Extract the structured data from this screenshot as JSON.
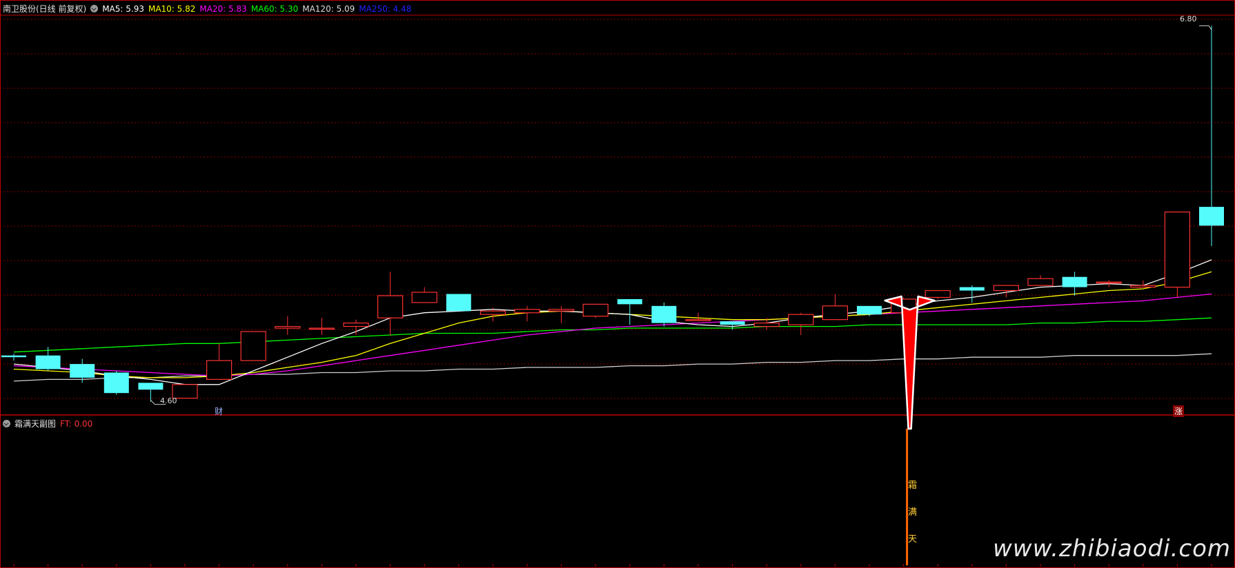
{
  "header": {
    "title": "南卫股份(日线 前复权)",
    "ma_items": [
      {
        "label": "MA5:",
        "value": "5.93",
        "color": "#ffffff"
      },
      {
        "label": "MA10:",
        "value": "5.82",
        "color": "#ffff00"
      },
      {
        "label": "MA20:",
        "value": "5.83",
        "color": "#ff00ff"
      },
      {
        "label": "MA60:",
        "value": "5.30",
        "color": "#00ff00"
      },
      {
        "label": "MA120:",
        "value": "5.09",
        "color": "#dddddd"
      },
      {
        "label": "MA250:",
        "value": "4.48",
        "color": "#2222ff"
      }
    ]
  },
  "sub_header": {
    "title": "霜满天副图",
    "ft_label": "FT:",
    "ft_value": "0.00",
    "ft_color": "#ff3333"
  },
  "labels": {
    "high_price": "6.80",
    "low_price": "4.60",
    "mark_cai": "财",
    "mark_zhang": "涨",
    "signal_chars": [
      "霜",
      "满",
      "天"
    ],
    "watermark": "www.zhibiaodi.com"
  },
  "colors": {
    "up": "#ff3232",
    "down": "#54fcfc",
    "grid": "#8a0000",
    "border": "#c00000",
    "ma5": "#ffffff",
    "ma10": "#ffff00",
    "ma20": "#ff00ff",
    "ma60": "#00ff00",
    "ma120": "#d0d0d0",
    "signal": "#ff6600",
    "arrow": "#ff0000"
  },
  "chart_data": {
    "type": "candlestick",
    "y_range": [
      4.55,
      6.85
    ],
    "high_label": 6.8,
    "low_label": 4.6,
    "candles": [
      {
        "o": 4.87,
        "c": 4.86,
        "h": 4.88,
        "l": 4.84
      },
      {
        "o": 4.87,
        "c": 4.79,
        "h": 4.92,
        "l": 4.78
      },
      {
        "o": 4.82,
        "c": 4.74,
        "h": 4.85,
        "l": 4.71
      },
      {
        "o": 4.77,
        "c": 4.65,
        "h": 4.78,
        "l": 4.64
      },
      {
        "o": 4.71,
        "c": 4.67,
        "h": 4.71,
        "l": 4.6
      },
      {
        "o": 4.62,
        "c": 4.7,
        "h": 4.7,
        "l": 4.62
      },
      {
        "o": 4.73,
        "c": 4.84,
        "h": 4.94,
        "l": 4.73
      },
      {
        "o": 4.84,
        "c": 5.01,
        "h": 5.01,
        "l": 4.84
      },
      {
        "o": 5.03,
        "c": 5.04,
        "h": 5.1,
        "l": 4.99
      },
      {
        "o": 5.03,
        "c": 5.03,
        "h": 5.09,
        "l": 4.99
      },
      {
        "o": 5.04,
        "c": 5.06,
        "h": 5.08,
        "l": 4.99
      },
      {
        "o": 5.09,
        "c": 5.22,
        "h": 5.36,
        "l": 4.99
      },
      {
        "o": 5.18,
        "c": 5.24,
        "h": 5.27,
        "l": 5.18
      },
      {
        "o": 5.23,
        "c": 5.13,
        "h": 5.23,
        "l": 5.13
      },
      {
        "o": 5.11,
        "c": 5.13,
        "h": 5.15,
        "l": 5.07
      },
      {
        "o": 5.12,
        "c": 5.14,
        "h": 5.16,
        "l": 5.07
      },
      {
        "o": 5.13,
        "c": 5.14,
        "h": 5.16,
        "l": 5.06
      },
      {
        "o": 5.1,
        "c": 5.17,
        "h": 5.17,
        "l": 5.09
      },
      {
        "o": 5.2,
        "c": 5.17,
        "h": 5.2,
        "l": 5.05
      },
      {
        "o": 5.16,
        "c": 5.06,
        "h": 5.18,
        "l": 5.04
      },
      {
        "o": 5.08,
        "c": 5.08,
        "h": 5.12,
        "l": 5.08
      },
      {
        "o": 5.07,
        "c": 5.05,
        "h": 5.07,
        "l": 5.02
      },
      {
        "o": 5.04,
        "c": 5.06,
        "h": 5.09,
        "l": 5.02
      },
      {
        "o": 5.05,
        "c": 5.11,
        "h": 5.12,
        "l": 4.99
      },
      {
        "o": 5.08,
        "c": 5.16,
        "h": 5.23,
        "l": 5.08
      },
      {
        "o": 5.16,
        "c": 5.11,
        "h": 5.16,
        "l": 5.1
      },
      {
        "o": 5.12,
        "c": 5.2,
        "h": 5.21,
        "l": 5.1
      },
      {
        "o": 5.21,
        "c": 5.25,
        "h": 5.25,
        "l": 5.2
      },
      {
        "o": 5.27,
        "c": 5.25,
        "h": 5.28,
        "l": 5.18
      },
      {
        "o": 5.25,
        "c": 5.28,
        "h": 5.28,
        "l": 5.21
      },
      {
        "o": 5.28,
        "c": 5.32,
        "h": 5.34,
        "l": 5.28
      },
      {
        "o": 5.33,
        "c": 5.27,
        "h": 5.36,
        "l": 5.22
      },
      {
        "o": 5.3,
        "c": 5.3,
        "h": 5.31,
        "l": 5.27
      },
      {
        "o": 5.27,
        "c": 5.28,
        "h": 5.31,
        "l": 5.27
      },
      {
        "o": 5.27,
        "c": 5.71,
        "h": 5.71,
        "l": 5.21
      },
      {
        "o": 5.74,
        "c": 5.63,
        "h": 6.8,
        "l": 5.51
      }
    ],
    "ma5": [
      4.82,
      4.8,
      4.78,
      4.75,
      4.73,
      4.7,
      4.7,
      4.78,
      4.86,
      4.94,
      5.01,
      5.09,
      5.12,
      5.13,
      5.14,
      5.13,
      5.13,
      5.12,
      5.11,
      5.07,
      5.05,
      5.04,
      5.06,
      5.09,
      5.11,
      5.13,
      5.16,
      5.19,
      5.21,
      5.24,
      5.27,
      5.28,
      5.29,
      5.28,
      5.35,
      5.43
    ],
    "ma10": [
      4.79,
      4.78,
      4.77,
      4.75,
      4.74,
      4.74,
      4.75,
      4.77,
      4.8,
      4.83,
      4.87,
      4.94,
      5.0,
      5.06,
      5.1,
      5.12,
      5.13,
      5.12,
      5.11,
      5.1,
      5.09,
      5.08,
      5.08,
      5.09,
      5.1,
      5.11,
      5.13,
      5.15,
      5.17,
      5.19,
      5.21,
      5.23,
      5.25,
      5.26,
      5.3,
      5.36
    ],
    "ma20": [
      4.81,
      4.8,
      4.79,
      4.78,
      4.77,
      4.76,
      4.75,
      4.76,
      4.78,
      4.81,
      4.84,
      4.87,
      4.9,
      4.93,
      4.96,
      4.99,
      5.01,
      5.03,
      5.04,
      5.05,
      5.06,
      5.07,
      5.08,
      5.09,
      5.1,
      5.11,
      5.12,
      5.13,
      5.14,
      5.15,
      5.16,
      5.17,
      5.18,
      5.19,
      5.21,
      5.23
    ],
    "ma60": [
      4.89,
      4.9,
      4.91,
      4.92,
      4.93,
      4.94,
      4.94,
      4.95,
      4.96,
      4.97,
      4.98,
      4.99,
      5.0,
      5.0,
      5.0,
      5.01,
      5.02,
      5.02,
      5.03,
      5.03,
      5.03,
      5.03,
      5.04,
      5.04,
      5.04,
      5.05,
      5.05,
      5.05,
      5.05,
      5.05,
      5.06,
      5.06,
      5.07,
      5.07,
      5.08,
      5.09
    ],
    "ma120": [
      4.72,
      4.73,
      4.73,
      4.74,
      4.74,
      4.75,
      4.75,
      4.76,
      4.76,
      4.77,
      4.77,
      4.78,
      4.78,
      4.79,
      4.79,
      4.8,
      4.8,
      4.8,
      4.81,
      4.81,
      4.82,
      4.82,
      4.83,
      4.83,
      4.84,
      4.84,
      4.85,
      4.85,
      4.86,
      4.86,
      4.86,
      4.87,
      4.87,
      4.87,
      4.87,
      4.88
    ],
    "signal_index": 26,
    "ft": [
      0,
      0,
      0,
      0,
      0,
      0,
      0,
      0,
      0,
      0,
      0,
      0,
      0,
      0,
      0,
      0,
      0,
      0,
      0,
      0,
      0,
      0,
      0,
      0,
      0,
      0,
      0,
      0,
      0,
      0,
      0,
      0,
      0,
      0,
      0,
      0
    ]
  }
}
